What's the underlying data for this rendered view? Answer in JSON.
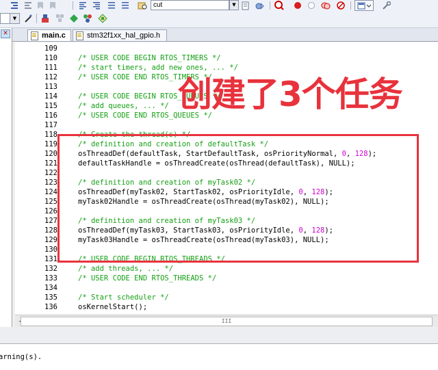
{
  "toolbar": {
    "find_text": "cut",
    "icons_row1": [
      "indent-icon",
      "outdent-icon",
      "bookmark-icon",
      "find-in-files-icon",
      "incremental-find-icon",
      "debug-icon",
      "breakpoint-icon",
      "breakpoint-disabled-icon",
      "kill-breakpoints-icon",
      "window-icon",
      "options-icon"
    ],
    "icons_row2": [
      "build-target-icon",
      "translate-icon",
      "load-icon",
      "rebuild-icon",
      "target-options-icon"
    ]
  },
  "tabs": [
    {
      "label": "main.c",
      "active": true
    },
    {
      "label": "stm32f1xx_hal_gpio.h",
      "active": false
    }
  ],
  "editor": {
    "line_numbers": [
      "109",
      "110",
      "111",
      "112",
      "113",
      "114",
      "115",
      "116",
      "117",
      "118",
      "119",
      "120",
      "121",
      "122",
      "123",
      "124",
      "125",
      "126",
      "127",
      "128",
      "129",
      "130",
      "131",
      "132",
      "133",
      "134",
      "135",
      "136"
    ],
    "lines": [
      {
        "parts": [
          {
            "t": "",
            "c": ""
          }
        ]
      },
      {
        "parts": [
          {
            "t": "/* USER CODE BEGIN RTOS_TIMERS */",
            "c": "cm"
          }
        ]
      },
      {
        "parts": [
          {
            "t": "/* start timers, add new ones, ... */",
            "c": "cm"
          }
        ]
      },
      {
        "parts": [
          {
            "t": "/* USER CODE END RTOS_TIMERS */",
            "c": "cm"
          }
        ]
      },
      {
        "parts": [
          {
            "t": "",
            "c": ""
          }
        ]
      },
      {
        "parts": [
          {
            "t": "/* USER CODE BEGIN RTOS_QUEUES */",
            "c": "cm"
          }
        ]
      },
      {
        "parts": [
          {
            "t": "/* add queues, ... */",
            "c": "cm"
          }
        ]
      },
      {
        "parts": [
          {
            "t": "/* USER CODE END RTOS_QUEUES */",
            "c": "cm"
          }
        ]
      },
      {
        "parts": [
          {
            "t": "",
            "c": ""
          }
        ]
      },
      {
        "parts": [
          {
            "t": "/* Create the thread(s) */",
            "c": "cm"
          }
        ]
      },
      {
        "parts": [
          {
            "t": "/* definition and creation of defaultTask */",
            "c": "cm"
          }
        ]
      },
      {
        "parts": [
          {
            "t": "osThreadDef(defaultTask, StartDefaultTask, osPriorityNormal, ",
            "c": ""
          },
          {
            "t": "0",
            "c": "num"
          },
          {
            "t": ", ",
            "c": ""
          },
          {
            "t": "128",
            "c": "num"
          },
          {
            "t": ");",
            "c": ""
          }
        ]
      },
      {
        "parts": [
          {
            "t": "defaultTaskHandle = osThreadCreate(osThread(defaultTask), NULL);",
            "c": ""
          }
        ]
      },
      {
        "parts": [
          {
            "t": "",
            "c": ""
          }
        ]
      },
      {
        "parts": [
          {
            "t": "/* definition and creation of myTask02 */",
            "c": "cm"
          }
        ]
      },
      {
        "parts": [
          {
            "t": "osThreadDef(myTask02, StartTask02, osPriorityIdle, ",
            "c": ""
          },
          {
            "t": "0",
            "c": "num"
          },
          {
            "t": ", ",
            "c": ""
          },
          {
            "t": "128",
            "c": "num"
          },
          {
            "t": ");",
            "c": ""
          }
        ]
      },
      {
        "parts": [
          {
            "t": "myTask02Handle = osThreadCreate(osThread(myTask02), NULL);",
            "c": ""
          }
        ]
      },
      {
        "parts": [
          {
            "t": "",
            "c": ""
          }
        ]
      },
      {
        "parts": [
          {
            "t": "/* definition and creation of myTask03 */",
            "c": "cm"
          }
        ]
      },
      {
        "parts": [
          {
            "t": "osThreadDef(myTask03, StartTask03, osPriorityIdle, ",
            "c": ""
          },
          {
            "t": "0",
            "c": "num"
          },
          {
            "t": ", ",
            "c": ""
          },
          {
            "t": "128",
            "c": "num"
          },
          {
            "t": ");",
            "c": ""
          }
        ]
      },
      {
        "parts": [
          {
            "t": "myTask03Handle = osThreadCreate(osThread(myTask03), NULL);",
            "c": ""
          }
        ]
      },
      {
        "parts": [
          {
            "t": "",
            "c": ""
          }
        ]
      },
      {
        "parts": [
          {
            "t": "/* USER CODE BEGIN RTOS_THREADS */",
            "c": "cm"
          }
        ]
      },
      {
        "parts": [
          {
            "t": "/* add threads, ... */",
            "c": "cm"
          }
        ]
      },
      {
        "parts": [
          {
            "t": "/* USER CODE END RTOS_THREADS */",
            "c": "cm"
          }
        ]
      },
      {
        "parts": [
          {
            "t": "",
            "c": ""
          }
        ]
      },
      {
        "parts": [
          {
            "t": "/* Start scheduler */",
            "c": "cm"
          }
        ]
      },
      {
        "parts": [
          {
            "t": "osKernelStart();",
            "c": ""
          }
        ]
      }
    ]
  },
  "scrollbar": {
    "thumb_grip": "III"
  },
  "annotation": {
    "caption": "创建了3个任务",
    "color": "#e8323c"
  },
  "output": {
    "text": "arning(s)."
  },
  "colors": {
    "comment": "#14a014",
    "number": "#d000d0",
    "annotation": "#e8323c"
  }
}
